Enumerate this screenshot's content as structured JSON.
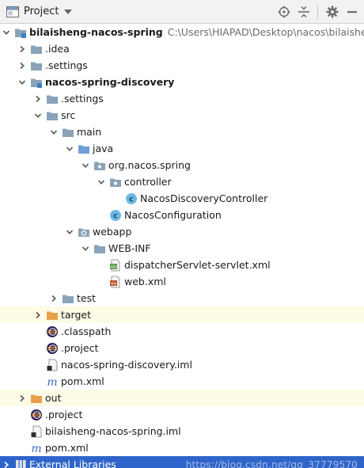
{
  "toolbar": {
    "title": "Project",
    "icons": [
      "project-view-icon",
      "dropdown-caret-icon",
      "locate-target-icon",
      "collapse-all-icon",
      "settings-gear-icon",
      "hide-panel-icon"
    ]
  },
  "colors": {
    "folder": "#8aa3b8",
    "source_folder": "#6fa0d6",
    "excluded_folder": "#e9a04a",
    "class_circle": "#6fb9e6",
    "selection": "#2f65ca",
    "highlight_row": "#fdfae6"
  },
  "tree": {
    "root": {
      "name": "bilaisheng-nacos-spring",
      "path": "C:\\Users\\HIAPAD\\Desktop\\nacos\\bilaisheng-n"
    },
    "idea": ".idea",
    "settings": ".settings",
    "module": "nacos-spring-discovery",
    "module_settings": ".settings",
    "src": "src",
    "main": "main",
    "java": "java",
    "package": "org.nacos.spring",
    "controller": "controller",
    "controller_class": "NacosDiscoveryController",
    "config_class": "NacosConfiguration",
    "webapp": "webapp",
    "webinf": "WEB-INF",
    "dispatcher_xml": "dispatcherServlet-servlet.xml",
    "web_xml": "web.xml",
    "test": "test",
    "target": "target",
    "classpath": ".classpath",
    "module_project": ".project",
    "module_iml": "nacos-spring-discovery.iml",
    "module_pom": "pom.xml",
    "out": "out",
    "root_project": ".project",
    "root_iml": "bilaisheng-nacos-spring.iml",
    "root_pom": "pom.xml",
    "external_libraries": "External Libraries"
  },
  "watermark": "https://blog.csdn.net/qq_37779570"
}
